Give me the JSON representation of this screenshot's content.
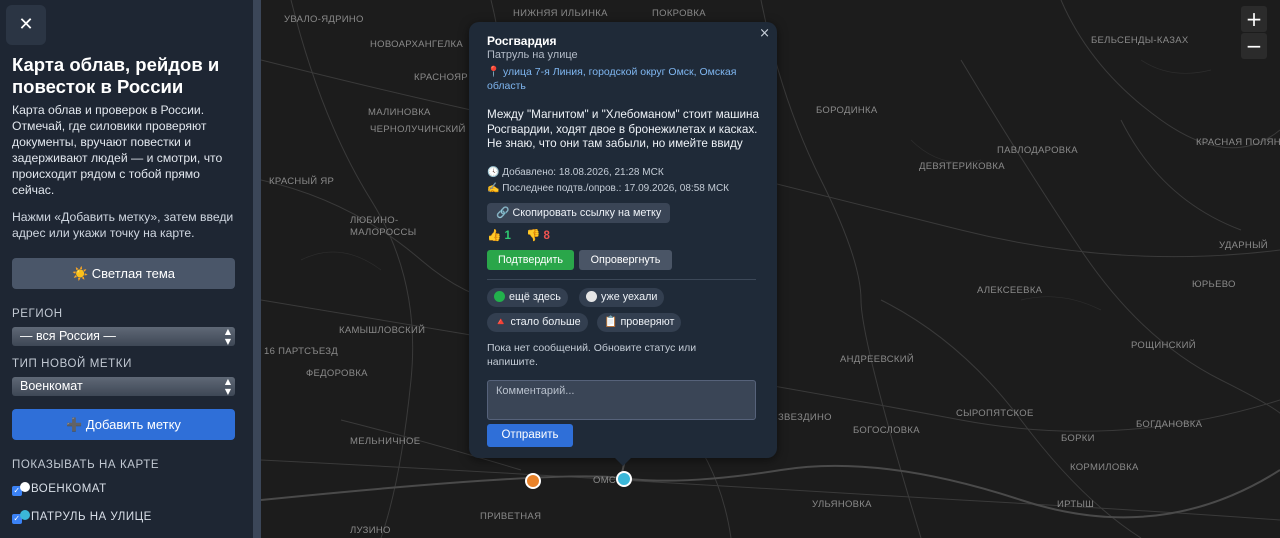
{
  "sidebar": {
    "close_glyph": "✕",
    "title": "Карта облав, рейдов и повесток в России",
    "description": "Карта облав и проверок в России. Отмечай, где силовики проверяют документы, вручают повестки и задерживают людей — и смотри, что происходит рядом с тобой прямо сейчас.",
    "hint": "Нажми «Добавить метку», затем введи адрес или укажи точку на карте.",
    "theme_button": "☀️ Светлая тема",
    "region_label": "РЕГИОН",
    "region_value": "— вся Россия —",
    "type_label": "ТИП НОВОЙ МЕТКИ",
    "type_value": "Военкомат",
    "add_button": "➕ Добавить метку",
    "show_label": "ПОКАЗЫВАТЬ НА КАРТЕ",
    "layers": [
      {
        "label": "ВОЕНКОМАТ",
        "color": "#ffffff"
      },
      {
        "label": "ПАТРУЛЬ НА УЛИЦЕ",
        "color": "#3bb7d8"
      }
    ]
  },
  "map": {
    "zoom_in": "+",
    "zoom_out": "−",
    "places": [
      "НИЖНЯЯ ИЛЬИНКА",
      "ПОКРОВКА",
      "УВАЛО-ЯДРИНО",
      "НОВОАРХАНГЕЛКА",
      "БЕЛЬСЕНДЫ-КАЗАХ",
      "КРАСНОЯР",
      "МАЛИНОВКА",
      "БОРОДИНКА",
      "ЧЕРНОЛУЧИНСКИЙ",
      "ПАВЛОДАРОВКА",
      "ДЕВЯТЕРИКОВКА",
      "КРАСНАЯ ПОЛЯНА",
      "КРАСНЫЙ ЯР",
      "ЛЮБИНО-МАЛОРОССЫ",
      "УДАРНЫЙ",
      "ЮРЬЕВО",
      "АЛЕКСЕЕВКА",
      "КАМЫШЛОВСКИЙ",
      "16 ПАРТСЪЕЗД",
      "РОЩИНСКИЙ",
      "АНДРЕЕВСКИЙ",
      "ФЕДОРОВКА",
      "СЫРОПЯТСКОЕ",
      "ЗВЕЗДИНО",
      "БОГОСЛОВКА",
      "БОГДАНОВКА",
      "БОРКИ",
      "МЕЛЬНИЧНОЕ",
      "КОРМИЛОВКА",
      "ОМСК",
      "ПРИВЕТНАЯ",
      "УЛЬЯНОВКА",
      "ИРТЫШ",
      "ЛУЗИНО"
    ],
    "marker_colors": [
      "#e8822a",
      "#3bb7d8"
    ]
  },
  "popup": {
    "close_glyph": "×",
    "title": "Росгвардия",
    "type": "Патруль на улице",
    "address": "📍 улица 7-я Линия, городской округ Омск, Омская область",
    "body": "Между \"Магнитом\" и \"Хлебоманом\" стоит машина Росгвардии, ходят двое в бронежилетах и касках. Не знаю, что они там забыли, но имейте ввиду",
    "added": "🕓 Добавлено: 18.08.2026, 21:28 МСК",
    "last_confirm": "✍️ Последнее подтв./опров.: 17.09.2026, 08:58 МСК",
    "copy_link": "🔗 Скопировать ссылку на метку",
    "likes": "👍 1",
    "dislikes": "👎 8",
    "confirm": "Подтвердить",
    "refute": "Опровергнуть",
    "chips": [
      {
        "label": "ещё здесь",
        "color": "#22b14c"
      },
      {
        "label": "уже уехали",
        "color": "#e6e6e6"
      },
      {
        "label": "🔺 стало больше"
      },
      {
        "label": "📋 проверяют"
      }
    ],
    "no_messages": "Пока нет сообщений. Обновите статус или напишите.",
    "comment_placeholder": "Комментарий...",
    "send": "Отправить",
    "like_color": "#2ecc71",
    "dislike_color": "#ef5350"
  }
}
